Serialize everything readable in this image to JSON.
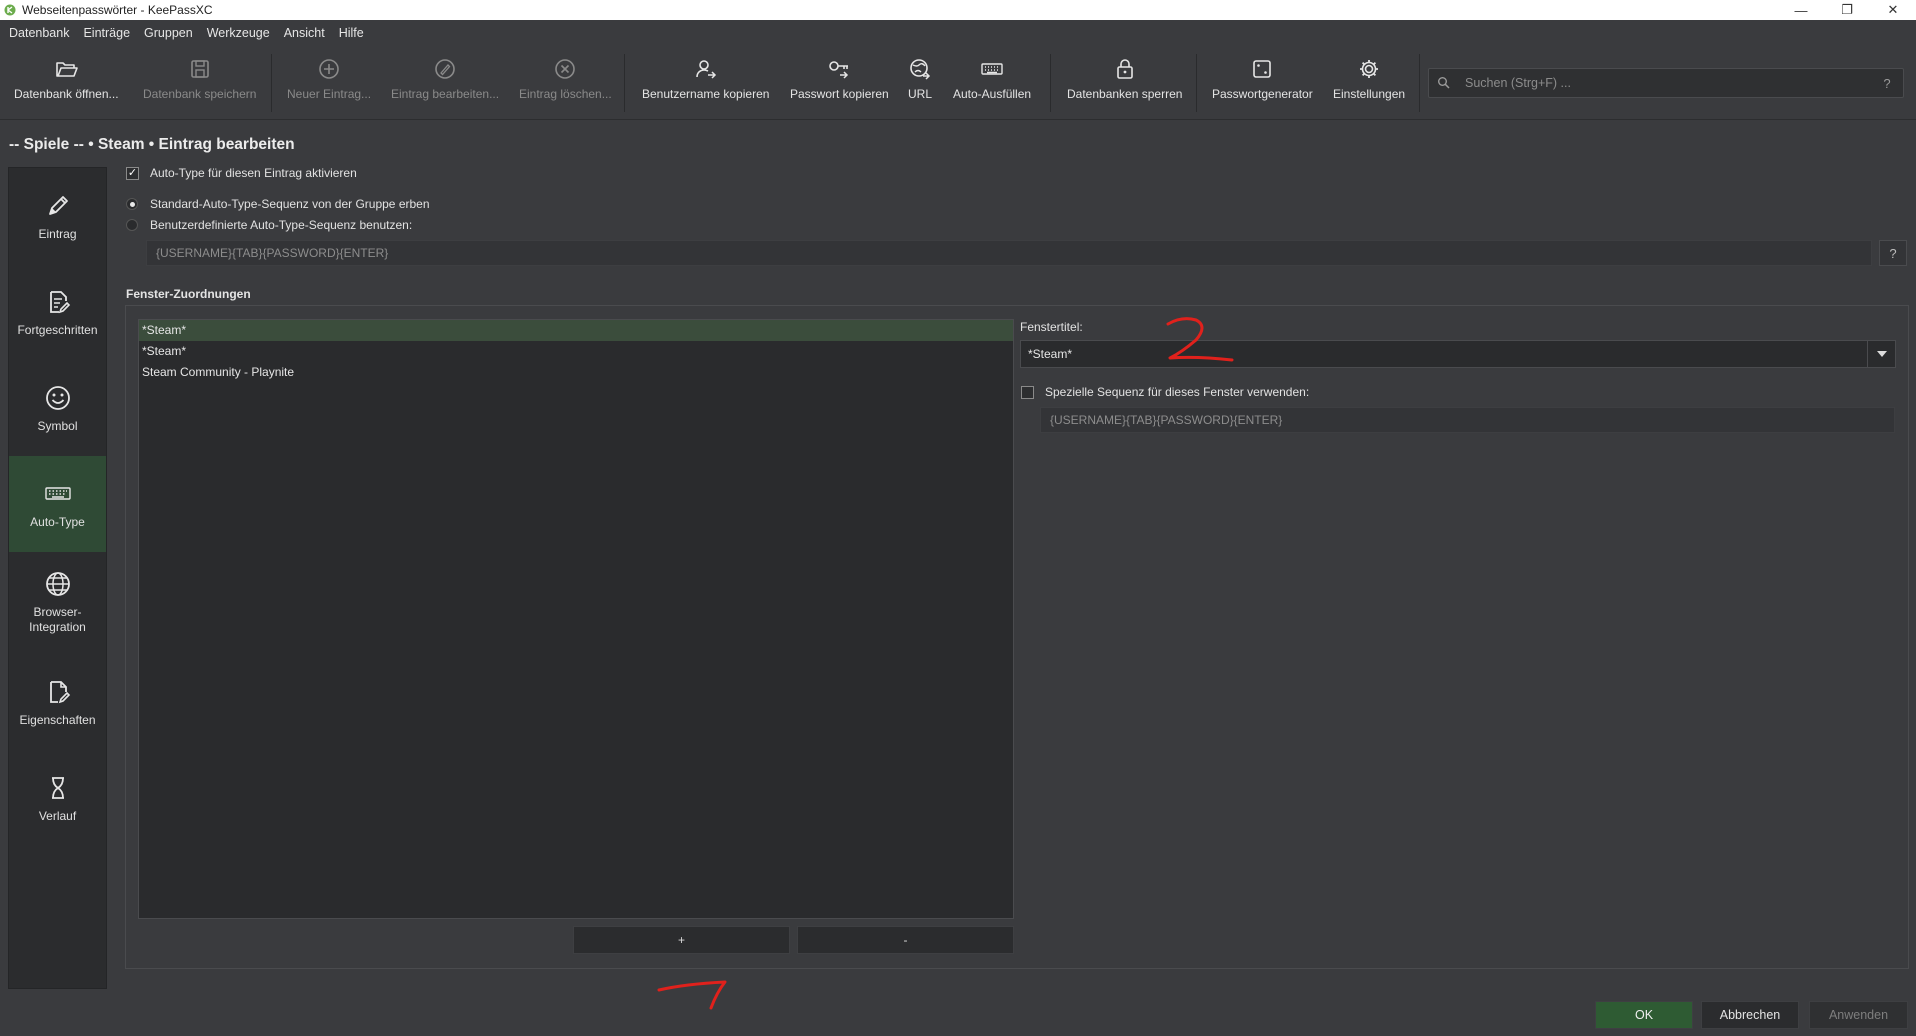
{
  "window": {
    "title": "Webseitenpasswörter - KeePassXC"
  },
  "menu": [
    "Datenbank",
    "Einträge",
    "Gruppen",
    "Werkzeuge",
    "Ansicht",
    "Hilfe"
  ],
  "toolbar": {
    "open_db": "Datenbank öffnen...",
    "save_db": "Datenbank speichern",
    "new_entry": "Neuer Eintrag...",
    "edit_entry": "Eintrag bearbeiten...",
    "delete_entry": "Eintrag löschen...",
    "copy_username": "Benutzername kopieren",
    "copy_password": "Passwort kopieren",
    "url": "URL",
    "autofill": "Auto-Ausfüllen",
    "lock_dbs": "Datenbanken sperren",
    "password_generator": "Passwortgenerator",
    "settings": "Einstellungen"
  },
  "search": {
    "placeholder": "Suchen (Strg+F) ...",
    "help": "?"
  },
  "page_title": "-- Spiele -- • Steam • Eintrag bearbeiten",
  "sidenav": {
    "items": [
      {
        "label": "Eintrag",
        "icon": "pencil-icon"
      },
      {
        "label": "Fortgeschritten",
        "icon": "document-edit-icon"
      },
      {
        "label": "Symbol",
        "icon": "smiley-icon"
      },
      {
        "label": "Auto-Type",
        "icon": "keyboard-icon"
      },
      {
        "label": "Browser-\nIntegration",
        "icon": "globe-icon"
      },
      {
        "label": "Eigenschaften",
        "icon": "document-properties-icon"
      },
      {
        "label": "Verlauf",
        "icon": "hourglass-icon"
      }
    ],
    "active": "Auto-Type"
  },
  "autotype": {
    "enable_label": "Auto-Type für diesen Eintrag aktivieren",
    "enable_checked": true,
    "inherit_label": "Standard-Auto-Type-Sequenz von der Gruppe erben",
    "custom_label": "Benutzerdefinierte Auto-Type-Sequenz benutzen:",
    "sequence_placeholder": "{USERNAME}{TAB}{PASSWORD}{ENTER}",
    "help": "?"
  },
  "window_assoc": {
    "title": "Fenster-Zuordnungen",
    "items": [
      "*Steam*",
      "*Steam*",
      "Steam Community - Playnite"
    ],
    "selected_index": 0,
    "add_label": "+",
    "remove_label": "-",
    "window_title_label": "Fenstertitel:",
    "window_title_value": "*Steam*",
    "special_seq_label": "Spezielle Sequenz für dieses Fenster verwenden:",
    "special_seq_placeholder": "{USERNAME}{TAB}{PASSWORD}{ENTER}"
  },
  "footer": {
    "ok": "OK",
    "cancel": "Abbrechen",
    "apply": "Anwenden"
  },
  "colors": {
    "accent_green": "#2f4a35",
    "ok_button": "#2e5b33",
    "annotation_red": "#e0211c"
  }
}
